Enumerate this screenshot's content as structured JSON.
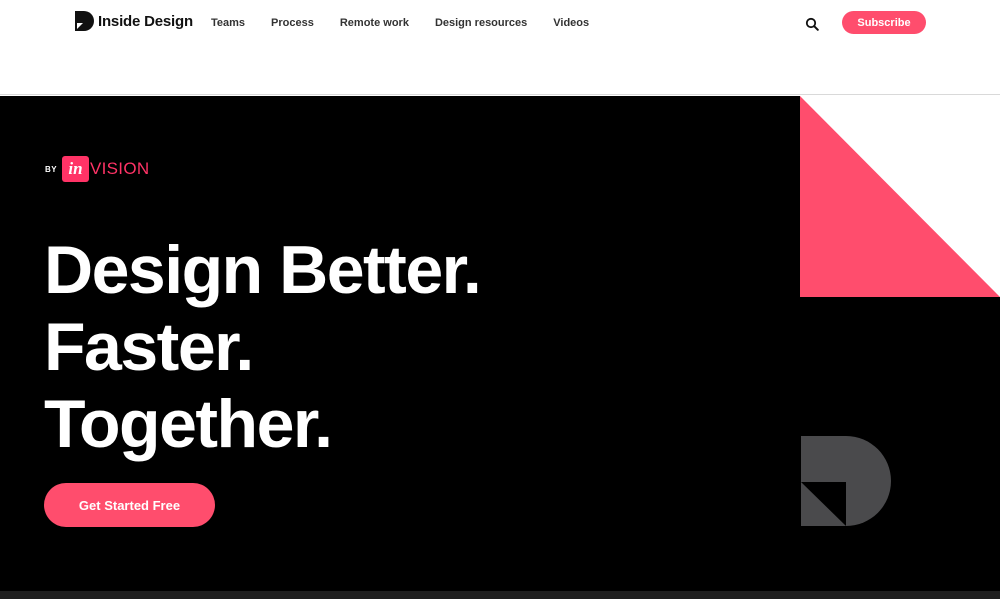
{
  "header": {
    "logo_text": "Inside Design",
    "nav": [
      "Teams",
      "Process",
      "Remote work",
      "Design resources",
      "Videos"
    ],
    "subscribe_label": "Subscribe"
  },
  "hero": {
    "by_label": "BY",
    "invision_badge": "in",
    "invision_rest": "VISION",
    "headline": [
      "Design Better.",
      "Faster.",
      "Together."
    ],
    "cta_label": "Get Started Free"
  },
  "colors": {
    "accent": "#ff4d6d",
    "invision_pink": "#ff3366",
    "hero_background": "#000000",
    "deco_gray": "#4a4a4c"
  },
  "icons": {
    "logo": "inside-design-logo-icon",
    "search": "search-icon"
  }
}
